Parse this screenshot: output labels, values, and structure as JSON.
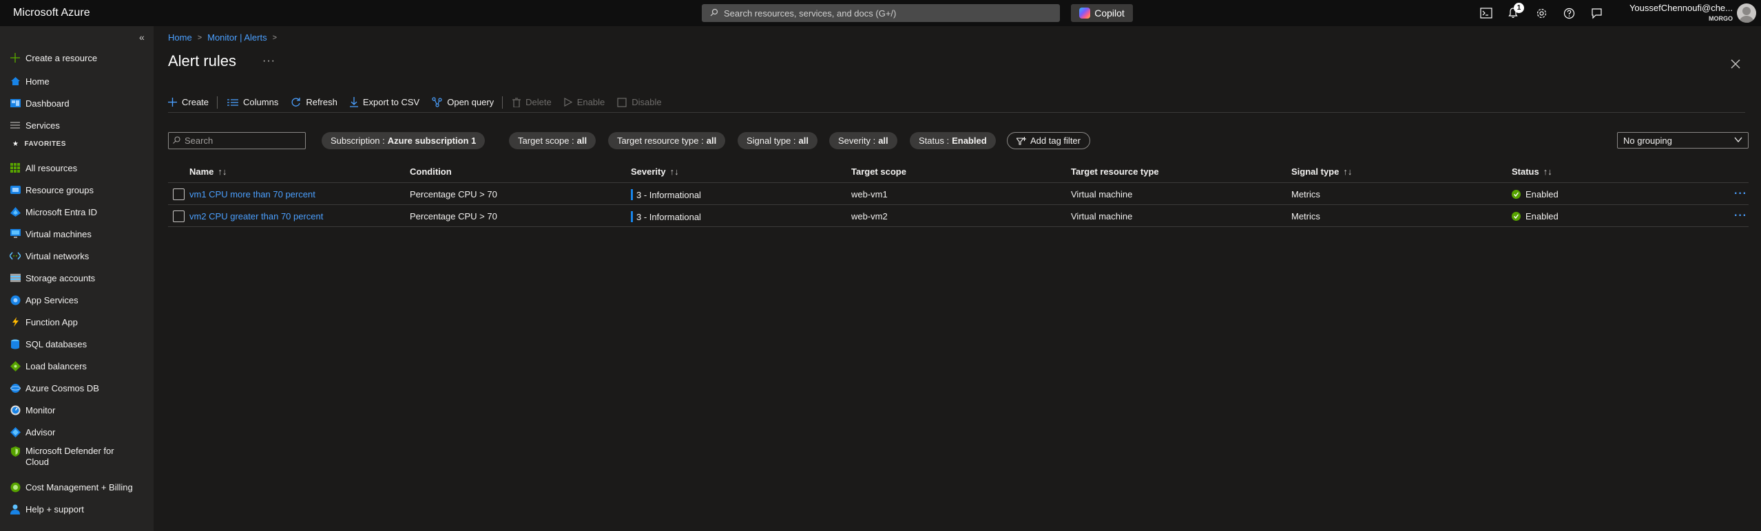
{
  "topbar": {
    "brand": "Microsoft Azure",
    "search_placeholder": "Search resources, services, and docs (G+/)",
    "copilot_label": "Copilot",
    "notification_count": "1",
    "user_name": "YoussefChennoufi@che...",
    "user_org": "MORGO"
  },
  "sidebar": {
    "collapse_glyph": "«",
    "favorites_label": "FAVORITES",
    "items": [
      {
        "label": "Create a resource",
        "icon": "plus-icon"
      },
      {
        "label": "Home",
        "icon": "home-icon"
      },
      {
        "label": "Dashboard",
        "icon": "dashboard-icon"
      },
      {
        "label": "Services",
        "icon": "services-icon"
      },
      {
        "label": "All resources",
        "icon": "all-resources-icon"
      },
      {
        "label": "Resource groups",
        "icon": "resource-groups-icon"
      },
      {
        "label": "Microsoft Entra ID",
        "icon": "entra-id-icon"
      },
      {
        "label": "Virtual machines",
        "icon": "virtual-machines-icon"
      },
      {
        "label": "Virtual networks",
        "icon": "virtual-networks-icon"
      },
      {
        "label": "Storage accounts",
        "icon": "storage-accounts-icon"
      },
      {
        "label": "App Services",
        "icon": "app-services-icon"
      },
      {
        "label": "Function App",
        "icon": "function-app-icon"
      },
      {
        "label": "SQL databases",
        "icon": "sql-databases-icon"
      },
      {
        "label": "Load balancers",
        "icon": "load-balancers-icon"
      },
      {
        "label": "Azure Cosmos DB",
        "icon": "cosmos-db-icon"
      },
      {
        "label": "Monitor",
        "icon": "monitor-icon"
      },
      {
        "label": "Advisor",
        "icon": "advisor-icon"
      },
      {
        "label": "Microsoft Defender for Cloud",
        "icon": "defender-icon"
      },
      {
        "label": "Cost Management + Billing",
        "icon": "cost-management-icon"
      },
      {
        "label": "Help + support",
        "icon": "help-support-icon"
      }
    ]
  },
  "main": {
    "breadcrumb": [
      "Home",
      "Monitor | Alerts"
    ],
    "title": "Alert rules",
    "more_glyph": "···",
    "toolbar": {
      "create": "Create",
      "columns": "Columns",
      "refresh": "Refresh",
      "export": "Export to CSV",
      "open_query": "Open query",
      "delete": "Delete",
      "enable": "Enable",
      "disable": "Disable"
    },
    "filters": {
      "search_placeholder": "Search",
      "subscription": {
        "label": "Subscription :",
        "value": "Azure subscription 1"
      },
      "target_scope": {
        "label": "Target scope :",
        "value": "all"
      },
      "target_resource_type": {
        "label": "Target resource type :",
        "value": "all"
      },
      "signal_type": {
        "label": "Signal type :",
        "value": "all"
      },
      "severity": {
        "label": "Severity :",
        "value": "all"
      },
      "status": {
        "label": "Status :",
        "value": "Enabled"
      },
      "add_tag": "Add tag filter",
      "grouping": "No grouping"
    },
    "table": {
      "columns": [
        "Name",
        "Condition",
        "Severity",
        "Target scope",
        "Target resource type",
        "Signal type",
        "Status"
      ],
      "sort_glyph": "↑↓",
      "rows": [
        {
          "name": "vm1 CPU more than 70 percent",
          "condition": "Percentage CPU > 70",
          "severity": "3 - Informational",
          "target_scope": "web-vm1",
          "resource_type": "Virtual machine",
          "signal_type": "Metrics",
          "status": "Enabled"
        },
        {
          "name": "vm2 CPU greater than 70 percent",
          "condition": "Percentage CPU > 70",
          "severity": "3 - Informational",
          "target_scope": "web-vm2",
          "resource_type": "Virtual machine",
          "signal_type": "Metrics",
          "status": "Enabled"
        }
      ]
    }
  },
  "colors": {
    "accent": "#4ba0ff",
    "severity_bar": "#1883e6",
    "status_ok": "#57a300",
    "topbar_bg": "#0f0f0f",
    "sidebar_bg": "#252423",
    "main_bg": "#1b1a19"
  }
}
